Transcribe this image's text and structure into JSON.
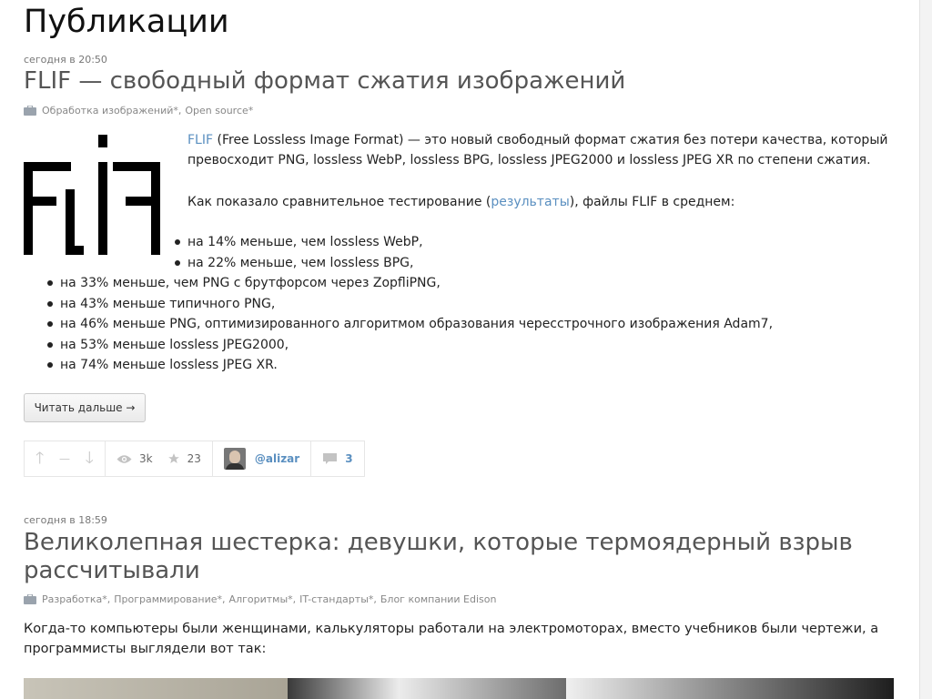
{
  "page": {
    "title": "Публикации"
  },
  "posts": [
    {
      "time": "сегодня в 20:50",
      "title": "FLIF — свободный формат сжатия изображений",
      "hubs": [
        "Обработка изображений*",
        "Open source*"
      ],
      "intro": {
        "link1": "FLIF",
        "text1": " (Free Lossless Image Format) — это новый свободный формат сжатия без потери качества, который превосходит PNG, lossless WebP, lossless BPG, lossless JPEG2000 и lossless JPEG XR по степени сжатия.",
        "text2a": "Как показало сравнительное тестирование (",
        "link2": "результаты",
        "text2b": "), файлы FLIF в среднем:"
      },
      "bullets": [
        "на 14% меньше, чем lossless WebP,",
        "на 22% меньше, чем lossless BPG,",
        "на 33% меньше, чем PNG с брутфорсом через ZopfliPNG,",
        "на 43% меньше типичного PNG,",
        "на 46% меньше PNG, оптимизированного алгоритмом образования чересстрочного изображения Adam7,",
        "на 53% меньше lossless JPEG2000,",
        "на 74% меньше lossless JPEG XR."
      ],
      "read_more": "Читать дальше →",
      "stats": {
        "rating": "—",
        "views": "3k",
        "favorites": "23",
        "author": "@alizar",
        "comments": "3"
      }
    },
    {
      "time": "сегодня в 18:59",
      "title": "Великолепная шестерка: девушки, которые термоядерный взрыв рассчитывали",
      "hubs": [
        "Разработка*",
        "Программирование*",
        "Алгоритмы*",
        "IT-стандарты*",
        "Блог компании Edison"
      ],
      "intro": "Когда-то компьютеры были женщинами, калькуляторы работали на электромоторах, вместо учебников были чертежи, а программисты выглядели вот так:"
    }
  ],
  "icons": {
    "hubs": "briefcase-icon",
    "up": "arrow-up-icon",
    "down": "arrow-down-icon",
    "views": "eye-icon",
    "favorites": "star-icon",
    "comments": "speech-bubble-icon"
  },
  "colors": {
    "link": "#5a8fc0",
    "title": "#555555",
    "muted": "#888888"
  }
}
